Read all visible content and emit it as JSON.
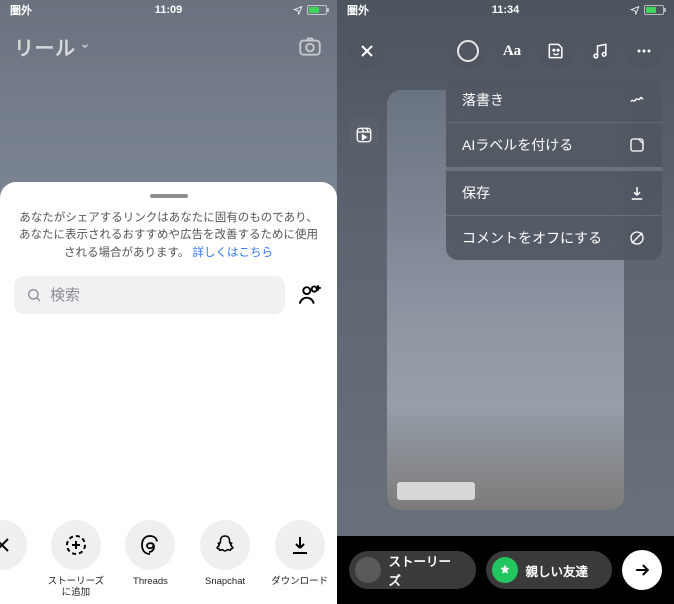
{
  "left": {
    "status": {
      "net": "圏外",
      "time": "11:09"
    },
    "title": "リール",
    "sheet": {
      "disclaimer": "あなたがシェアするリンクはあなたに固有のものであり、あなたに表示されるおすすめや広告を改善するために使用される場合があります。",
      "learn_more": "詳しくはこちら",
      "search_placeholder": "検索"
    },
    "share": [
      {
        "label": "ストーリーズ\nに追加",
        "icon": "add-story-icon"
      },
      {
        "label": "Threads",
        "icon": "threads-icon"
      },
      {
        "label": "Snapchat",
        "icon": "snapchat-icon"
      },
      {
        "label": "ダウンロード",
        "icon": "download-icon"
      }
    ]
  },
  "right": {
    "status": {
      "net": "圏外",
      "time": "11:34"
    },
    "menu": {
      "doodle": "落書き",
      "ai_label": "AIラベルを付ける",
      "save": "保存",
      "comments_off": "コメントをオフにする"
    },
    "bottom": {
      "stories": "ストーリーズ",
      "close_friends": "親しい友達"
    }
  }
}
